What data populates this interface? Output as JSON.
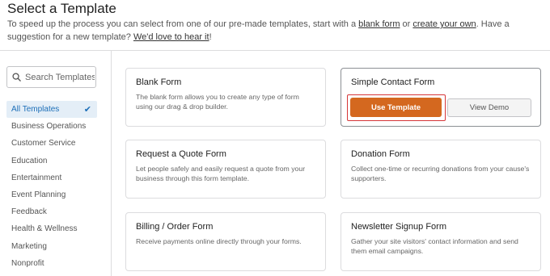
{
  "page": {
    "title": "Select a Template",
    "intro_before_link1": "To speed up the process you can select from one of our pre-made templates, start with a ",
    "link_blank_form": "blank form",
    "intro_between_links": " or ",
    "link_create_own": "create your own",
    "intro_after_link2": ". Have a suggestion for a new template? ",
    "link_love_to_hear": "We'd love to hear it",
    "intro_end": "!"
  },
  "sidebar": {
    "search_placeholder": "Search Templates",
    "categories": [
      {
        "label": "All Templates",
        "active": true
      },
      {
        "label": "Business Operations"
      },
      {
        "label": "Customer Service"
      },
      {
        "label": "Education"
      },
      {
        "label": "Entertainment"
      },
      {
        "label": "Event Planning"
      },
      {
        "label": "Feedback"
      },
      {
        "label": "Health & Wellness"
      },
      {
        "label": "Marketing"
      },
      {
        "label": "Nonprofit"
      }
    ]
  },
  "templates": [
    {
      "name": "Blank Form",
      "description": "The blank form allows you to create any type of form using our drag & drop builder."
    },
    {
      "name": "Simple Contact Form",
      "description": "",
      "use_label": "Use Template",
      "demo_label": "View Demo"
    },
    {
      "name": "Request a Quote Form",
      "description": "Let people safely and easily request a quote from your business through this form template."
    },
    {
      "name": "Donation Form",
      "description": "Collect one-time or recurring donations from your cause's supporters."
    },
    {
      "name": "Billing / Order Form",
      "description": "Receive payments online directly through your forms."
    },
    {
      "name": "Newsletter Signup Form",
      "description": "Gather your site visitors' contact information and send them email campaigns."
    }
  ],
  "colors": {
    "accent": "#d4681f",
    "highlight_outline": "#d63638",
    "active_category": "#1d6fb8"
  },
  "icons": {
    "search": "search-icon",
    "active_check": "checkmark-icon"
  }
}
